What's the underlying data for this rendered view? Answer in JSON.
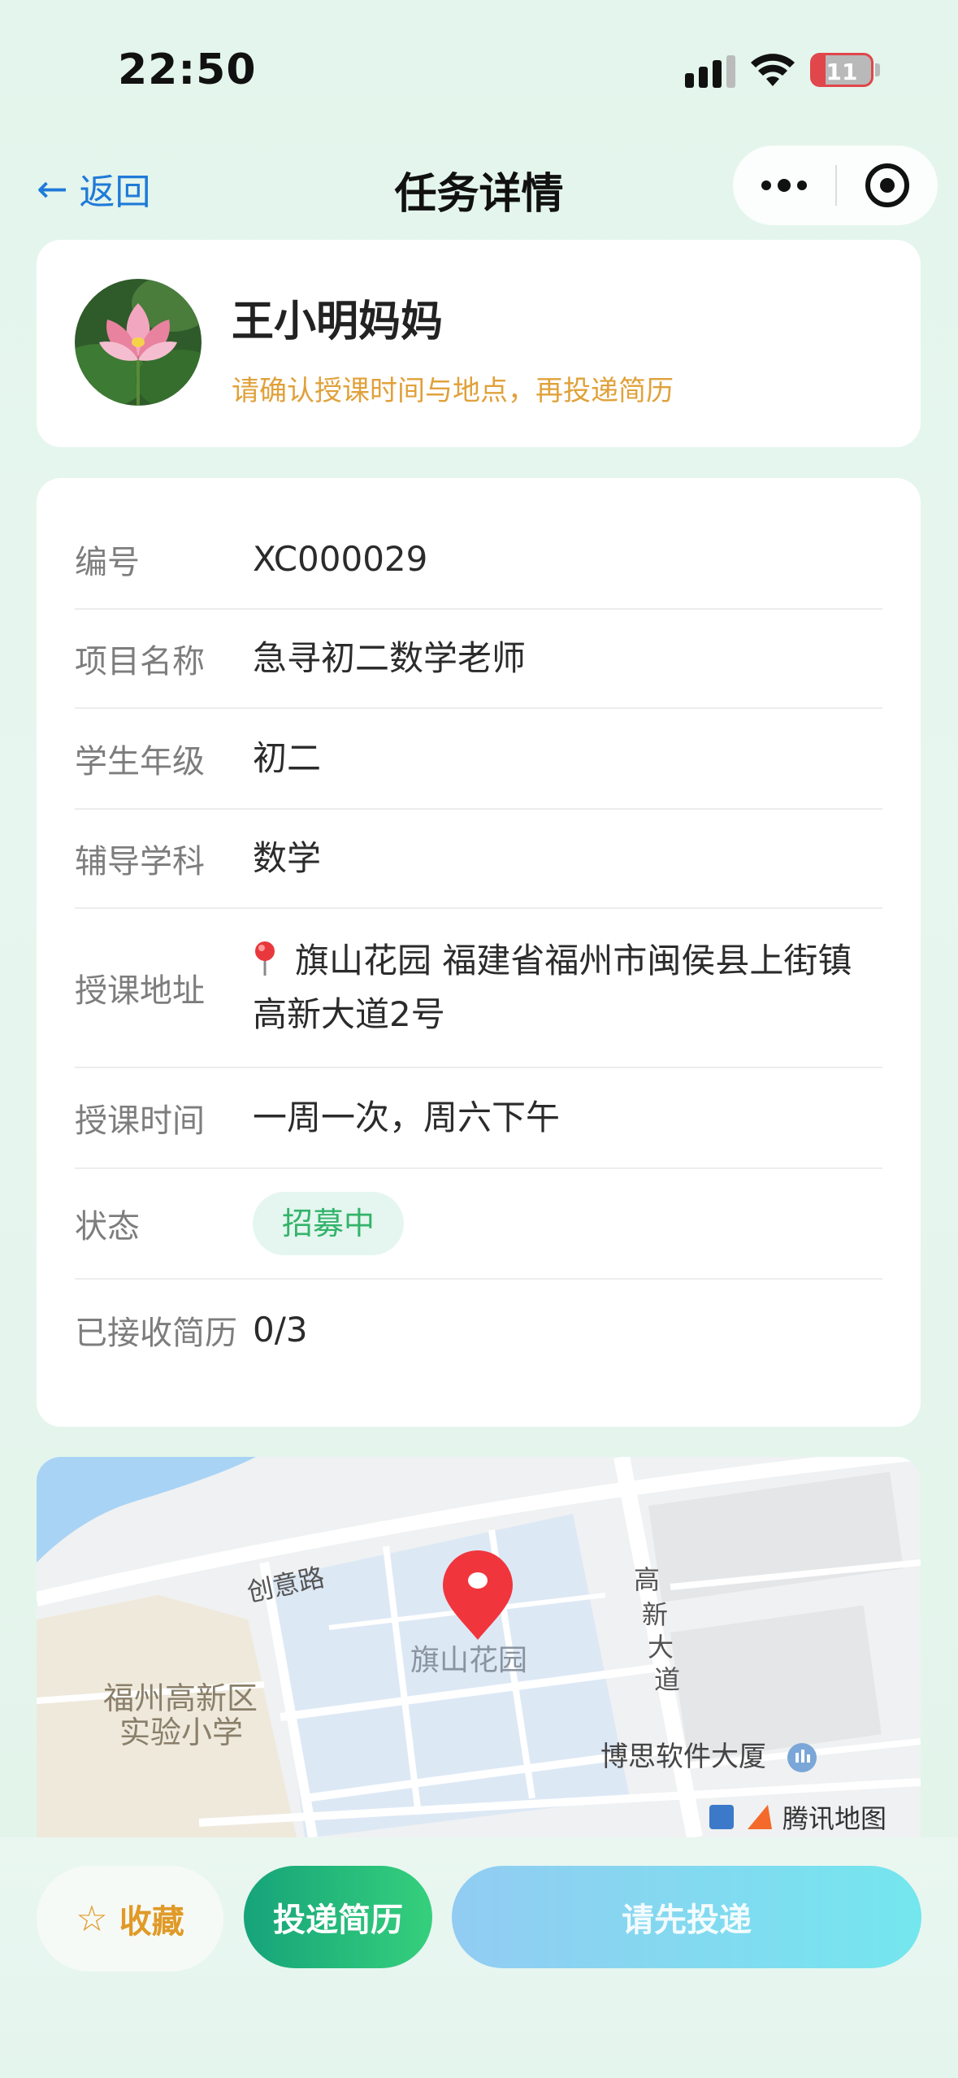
{
  "status_bar": {
    "time": "22:50",
    "battery": "11"
  },
  "nav": {
    "back_label": "返回",
    "back_arrow": "←",
    "title": "任务详情"
  },
  "profile": {
    "name": "王小明妈妈",
    "hint": "请确认授课时间与地点，再投递简历"
  },
  "details": {
    "rows": [
      {
        "label": "编号",
        "value": "XC000029"
      },
      {
        "label": "项目名称",
        "value": "急寻初二数学老师"
      },
      {
        "label": "学生年级",
        "value": "初二"
      },
      {
        "label": "辅导学科",
        "value": "数学"
      },
      {
        "label": "授课地址",
        "value": "旗山花园 福建省福州市闽侯县上街镇高新大道2号"
      },
      {
        "label": "授课时间",
        "value": "一周一次，周六下午"
      },
      {
        "label": "状态",
        "value": "招募中"
      },
      {
        "label": "已接收简历",
        "value": "0/3"
      }
    ]
  },
  "map": {
    "labels": {
      "road_chuangyi": "创意路",
      "road_gaoxin": "高新大道",
      "poi_main": "旗山花园",
      "poi_school_line1": "福州高新区",
      "poi_school_line2": "实验小学",
      "poi_bosi": "博思软件大厦",
      "provider": "腾讯地图"
    },
    "colors": {
      "water": "#a9d3f5",
      "residential": "#dde8f5",
      "school": "#efe9dc",
      "pin": "#f0353d"
    }
  },
  "actions": {
    "favorite_label": "收藏",
    "favorite_icon": "☆",
    "submit_label": "投递简历",
    "disabled_label": "请先投递"
  }
}
